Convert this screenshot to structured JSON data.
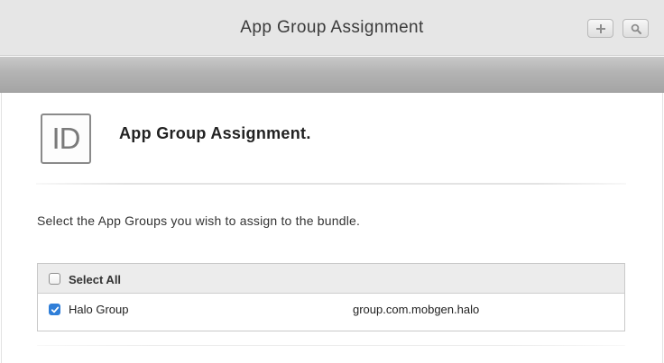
{
  "header": {
    "title": "App Group Assignment",
    "add_icon": "plus-icon",
    "search_icon": "search-icon"
  },
  "section": {
    "icon_text": "ID",
    "title": "App Group Assignment."
  },
  "instructions": "Select the App Groups you wish to assign to the bundle.",
  "table": {
    "select_all": {
      "label": "Select All",
      "checked": false
    },
    "rows": [
      {
        "name": "Halo Group",
        "identifier": "group.com.mobgen.halo",
        "checked": true
      }
    ]
  },
  "colors": {
    "checkbox_accent": "#2f7ed8",
    "header_bg": "#e6e6e6",
    "band": "#b3b3b3"
  }
}
